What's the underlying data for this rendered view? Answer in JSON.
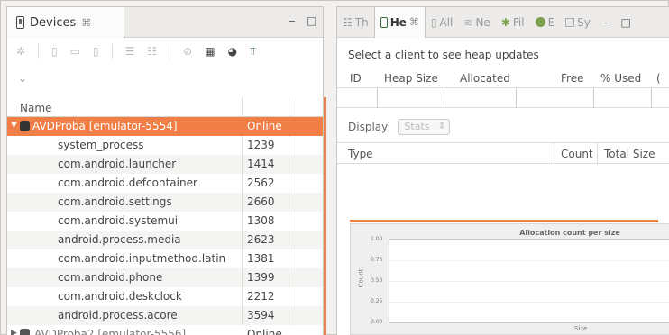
{
  "devices": {
    "tab_title": "Devices",
    "tab_close": "⌘",
    "minimize": "‒",
    "maximize": "□",
    "toolbar_icons": [
      "bug-icon",
      "device-icon",
      "stack-icon",
      "device2-icon",
      "thread-icon",
      "heap-icon",
      "gc-icon",
      "camera-icon",
      "globe-icon",
      "more-icon"
    ],
    "column_name": "Name",
    "selected_device": {
      "name": "AVDProba [emulator-5554]",
      "status": "Online"
    },
    "processes": [
      {
        "name": "system_process",
        "pid": "1239"
      },
      {
        "name": "com.android.launcher",
        "pid": "1414"
      },
      {
        "name": "com.android.defcontainer",
        "pid": "2562"
      },
      {
        "name": "com.android.settings",
        "pid": "2660"
      },
      {
        "name": "com.android.systemui",
        "pid": "1308"
      },
      {
        "name": "android.process.media",
        "pid": "2623"
      },
      {
        "name": "com.android.inputmethod.latin",
        "pid": "1381"
      },
      {
        "name": "com.android.phone",
        "pid": "1399"
      },
      {
        "name": "com.android.deskclock",
        "pid": "2212"
      },
      {
        "name": "android.process.acore",
        "pid": "3594"
      }
    ],
    "second_device": {
      "name": "AVDProba2 [emulator-5556]",
      "status": "Online"
    }
  },
  "heap": {
    "tabs": [
      {
        "label": "Th",
        "icon": "threads-icon"
      },
      {
        "label": "He",
        "icon": "heap-icon",
        "active": true
      },
      {
        "label": "All",
        "icon": "allocation-icon"
      },
      {
        "label": "Ne",
        "icon": "network-icon"
      },
      {
        "label": "Fil",
        "icon": "file-explorer-icon"
      },
      {
        "label": "E",
        "icon": "emulator-icon"
      },
      {
        "label": "Sy",
        "icon": "sysinfo-icon"
      }
    ],
    "heap_tab_close": "⌘",
    "prompt": "Select a client to see heap updates",
    "columns": [
      "ID",
      "Heap Size",
      "Allocated",
      "Free",
      "% Used",
      "("
    ],
    "display_label": "Display:",
    "display_value": "Stats",
    "type_columns": [
      "Type",
      "Count",
      "Total Size"
    ],
    "minimize": "‒",
    "maximize": "□"
  },
  "chart_data": {
    "type": "bar",
    "title": "Allocation count per size",
    "xlabel": "Size",
    "ylabel": "Count",
    "y_ticks": [
      "1.00",
      "0.75",
      "0.50",
      "0.25",
      "0.00"
    ],
    "ylim": [
      0,
      1
    ],
    "categories": [],
    "values": []
  }
}
